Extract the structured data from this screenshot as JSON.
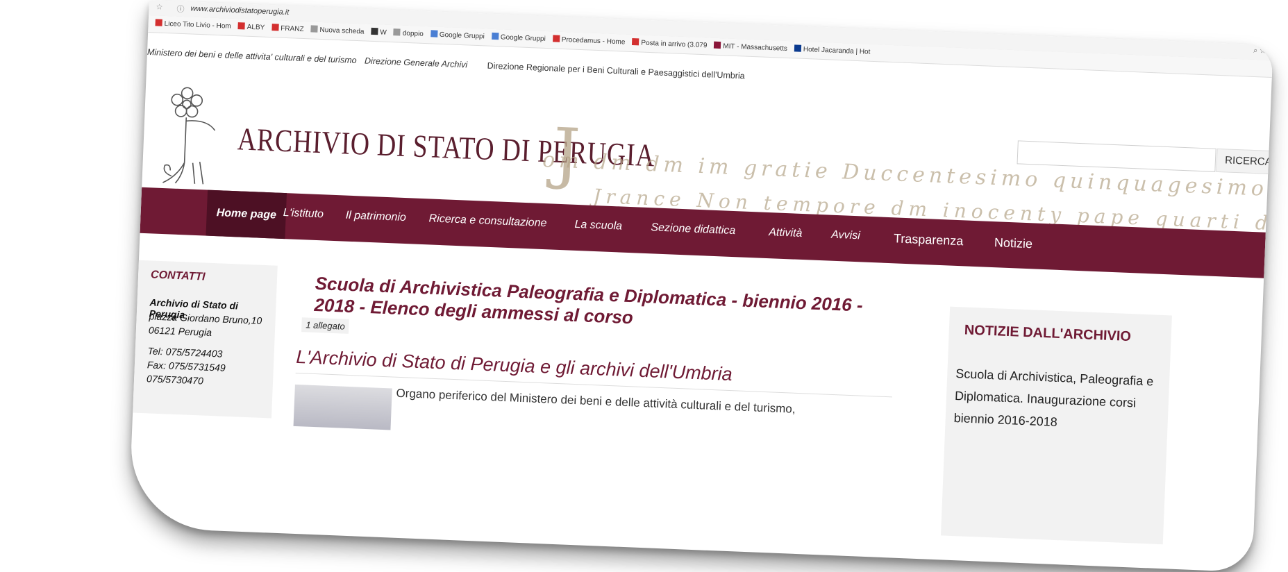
{
  "browser": {
    "url": "www.archiviodistatoperugia.it",
    "bookmarks": [
      {
        "label": "Liceo Tito Livio - Hom",
        "icon": "red-square-icon",
        "color": "#d32f2f"
      },
      {
        "label": "ALBY",
        "icon": "red-square-icon",
        "color": "#d32f2f"
      },
      {
        "label": "FRANZ",
        "icon": "red-square-icon",
        "color": "#d32f2f"
      },
      {
        "label": "Nuova scheda",
        "icon": "page-icon",
        "color": "#999999"
      },
      {
        "label": "W",
        "icon": "wikipedia-icon",
        "color": "#333333"
      },
      {
        "label": "doppio",
        "icon": "page-icon",
        "color": "#999999"
      },
      {
        "label": "Google Gruppi",
        "icon": "groups-icon",
        "color": "#4a7fd4"
      },
      {
        "label": "Google Gruppi",
        "icon": "groups-icon",
        "color": "#4a7fd4"
      },
      {
        "label": "Procedamus - Home",
        "icon": "red-square-icon",
        "color": "#d32f2f"
      },
      {
        "label": "Posta in arrivo (3.079",
        "icon": "gmail-icon",
        "color": "#d32f2f"
      },
      {
        "label": "MIT - Massachusetts",
        "icon": "mit-icon",
        "color": "#8a1538"
      },
      {
        "label": "Hotel Jacaranda | Hot",
        "icon": "hotel-icon",
        "color": "#0b3a8f"
      }
    ]
  },
  "topline": {
    "ministry": "Ministero dei beni e delle attivita' culturali e del turismo",
    "dga": "Direzione Generale Archivi",
    "regional": "Direzione Regionale per i Beni Culturali e Paesaggistici dell'Umbria"
  },
  "header": {
    "title": "ARCHIVIO DI STATO DI PERUGIA",
    "initial": "J",
    "script_line1": "om dm dm im gratie Duccentesimo quinquagesimo",
    "script_line2": "Jrance Non tempore dm inocenty pape quarti die mensis",
    "search_placeholder": "",
    "search_button": "RICERCA"
  },
  "nav": {
    "items": [
      "Home page",
      "L'istituto",
      "Il patrimonio",
      "Ricerca e consultazione",
      "La scuola",
      "Sezione didattica",
      "Attività",
      "Avvisi",
      "Trasparenza",
      "Notizie"
    ]
  },
  "contacts": {
    "heading": "CONTATTI",
    "org": "Archivio di Stato di Perugia",
    "address1": "piazza Giordano Bruno,10",
    "address2": "06121 Perugia",
    "tel": "Tel: 075/5724403",
    "fax": "Fax: 075/5731549",
    "extra": "075/5730470"
  },
  "main": {
    "news_title": "Scuola di Archivistica Paleografia e Diplomatica - biennio 2016 - 2018 - Elenco degli ammessi al corso",
    "attachment": "1 allegato",
    "section_title": "L'Archivio di Stato di Perugia e gli archivi dell'Umbria",
    "body": "Organo periferico del Ministero dei beni e delle attività culturali e del turismo,"
  },
  "right_box": {
    "heading": "NOTIZIE DALL'ARCHIVIO",
    "text": "Scuola di Archivistica, Paleografia e Diplomatica. Inaugurazione corsi biennio 2016-2018"
  }
}
